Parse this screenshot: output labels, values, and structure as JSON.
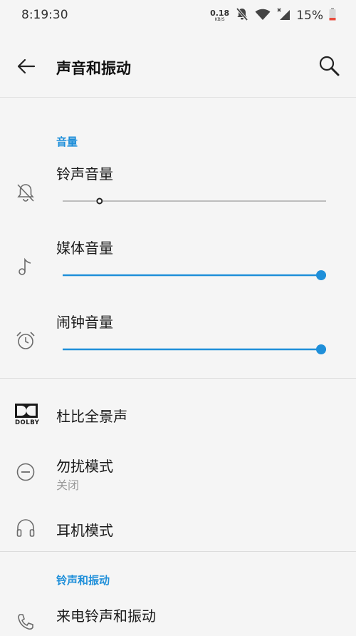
{
  "status": {
    "time": "8:19:30",
    "net_speed_value": "0.18",
    "net_speed_unit": "KB/S",
    "battery": "15%"
  },
  "header": {
    "title": "声音和振动"
  },
  "volume": {
    "section_title": "音量",
    "ringtone": {
      "label": "铃声音量",
      "level": 0.14
    },
    "media": {
      "label": "媒体音量",
      "level": 1.0
    },
    "alarm": {
      "label": "闹钟音量",
      "level": 1.0
    }
  },
  "items": {
    "dolby": {
      "label": "杜比全景声",
      "icon_text": "DOLBY"
    },
    "dnd": {
      "label": "勿扰模式",
      "sub": "关闭"
    },
    "headphone": {
      "label": "耳机模式"
    }
  },
  "ring_vibrate": {
    "section_title": "铃声和振动",
    "first_item": "来电铃声和振动"
  },
  "colors": {
    "accent": "#1f8fd9",
    "track_inactive": "#bdbdbd",
    "icon_gray": "#6b6b6b"
  }
}
